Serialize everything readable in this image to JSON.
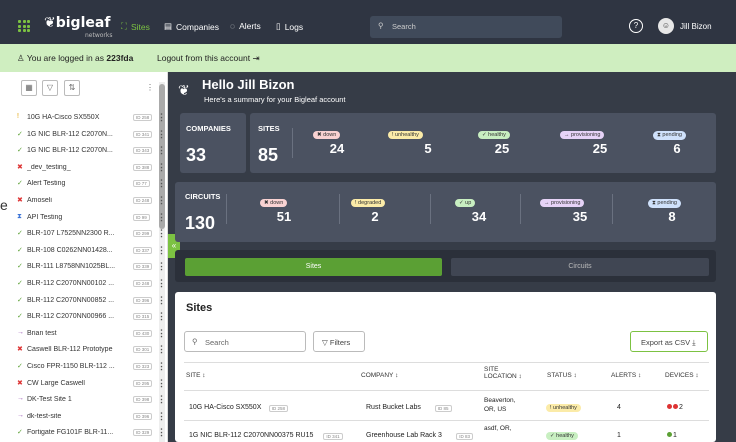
{
  "header": {
    "logo": "bigleaf",
    "logo_sub": "networks",
    "nav": [
      {
        "label": "Sites"
      },
      {
        "label": "Companies"
      },
      {
        "label": "Alerts"
      },
      {
        "label": "Logs"
      }
    ],
    "search_placeholder": "Search",
    "user": "Jill Bizon"
  },
  "banner": {
    "prefix": "You are logged in as",
    "account": "223fda",
    "logout": "Logout from this account"
  },
  "sidebar": {
    "items": [
      {
        "status": "!",
        "label": "10G HA-Cisco SX550X",
        "badge": "ID 258",
        "color": "#e0a000"
      },
      {
        "status": "✓",
        "label": "1G NIC BLR-112 C2070N...",
        "badge": "ID 341",
        "color": "#5ba034"
      },
      {
        "status": "✓",
        "label": "1G NIC BLR-112 C2070N...",
        "badge": "ID 343",
        "color": "#5ba034"
      },
      {
        "status": "✖",
        "label": "_dev_testing_",
        "badge": "ID 388",
        "color": "#d33"
      },
      {
        "status": "✓",
        "label": "Alert Testing",
        "badge": "ID 77",
        "color": "#5ba034"
      },
      {
        "status": "✖",
        "label": "Amoseli",
        "badge": "ID 248",
        "color": "#d33"
      },
      {
        "status": "⧗",
        "label": "API Testing",
        "badge": "ID 99",
        "color": "#3b73d6"
      },
      {
        "status": "✓",
        "label": "BLR-107 L7525NN2300 R...",
        "badge": "ID 299",
        "color": "#5ba034"
      },
      {
        "status": "✓",
        "label": "BLR-108 C0262NN01428...",
        "badge": "ID 337",
        "color": "#5ba034"
      },
      {
        "status": "✓",
        "label": "BLR-111 L8758NN1025BL...",
        "badge": "ID 339",
        "color": "#5ba034"
      },
      {
        "status": "✓",
        "label": "BLR-112 C2070NN00102 ...",
        "badge": "ID 248",
        "color": "#5ba034"
      },
      {
        "status": "✓",
        "label": "BLR-112 C2070NN00852 ...",
        "badge": "ID 396",
        "color": "#5ba034"
      },
      {
        "status": "✓",
        "label": "BLR-112 C2070NN00966 ...",
        "badge": "ID 315",
        "color": "#5ba034"
      },
      {
        "status": "→",
        "label": "Brian test",
        "badge": "ID 430",
        "color": "#9b59b6"
      },
      {
        "status": "✖",
        "label": "Caswell BLR-112 Prototype",
        "badge": "ID 301",
        "color": "#d33"
      },
      {
        "status": "✓",
        "label": "Cisco FPR-1150 BLR-112 ...",
        "badge": "ID 323",
        "color": "#5ba034"
      },
      {
        "status": "✖",
        "label": "CW Large Caswell",
        "badge": "ID 295",
        "color": "#d33"
      },
      {
        "status": "→",
        "label": "DK-Test Site 1",
        "badge": "ID 398",
        "color": "#9b59b6"
      },
      {
        "status": "→",
        "label": "dk-test-site",
        "badge": "ID 396",
        "color": "#9b59b6"
      },
      {
        "status": "✓",
        "label": "Fortigate FG101F BLR-11...",
        "badge": "ID 329",
        "color": "#5ba034"
      }
    ]
  },
  "summary": {
    "greeting": "Hello Jill Bizon",
    "subtitle": "Here's a summary for your Bigleaf account"
  },
  "cards": {
    "companies": {
      "label": "COMPANIES",
      "value": "33"
    },
    "sites": {
      "label": "SITES",
      "value": "85",
      "stats": [
        {
          "label": "down",
          "value": "24"
        },
        {
          "label": "unhealthy",
          "value": "5"
        },
        {
          "label": "healthy",
          "value": "25"
        },
        {
          "label": "provisioning",
          "value": "25"
        },
        {
          "label": "pending",
          "value": "6"
        }
      ]
    },
    "circuits": {
      "label": "CIRCUITS",
      "value": "130",
      "stats": [
        {
          "label": "down",
          "value": "51"
        },
        {
          "label": "degraded",
          "value": "2"
        },
        {
          "label": "up",
          "value": "34"
        },
        {
          "label": "provisioning",
          "value": "35"
        },
        {
          "label": "pending",
          "value": "8"
        }
      ]
    }
  },
  "tabs": {
    "sites": "Sites",
    "circuits": "Circuits"
  },
  "panel": {
    "title": "Sites",
    "search_placeholder": "Search",
    "filters": "Filters",
    "export": "Export as CSV",
    "columns": [
      "SITE",
      "COMPANY",
      "SITE LOCATION",
      "STATUS",
      "ALERTS",
      "DEVICES"
    ],
    "rows": [
      {
        "site": "10G HA-Cisco SX550X",
        "badge": "ID 258",
        "company": "Rust Bucket Labs",
        "cbadge": "ID 85",
        "loc1": "Beaverton,",
        "loc2": "OR, US",
        "status": "unhealthy",
        "alerts": "4",
        "devices": "2"
      },
      {
        "site": "1G NIC BLR-112 C2070NN00375 RU15",
        "badge": "ID 341",
        "company": "Greenhouse Lab Rack 3",
        "cbadge": "ID 83",
        "loc1": "asdf, OR,",
        "loc2": "",
        "status": "healthy",
        "alerts": "1",
        "devices": "1"
      }
    ]
  },
  "icons": {
    "accent": "#7cc242",
    "header_bg": "#2f3542",
    "main_bg": "#363c47",
    "card_bg": "#4b5261"
  }
}
